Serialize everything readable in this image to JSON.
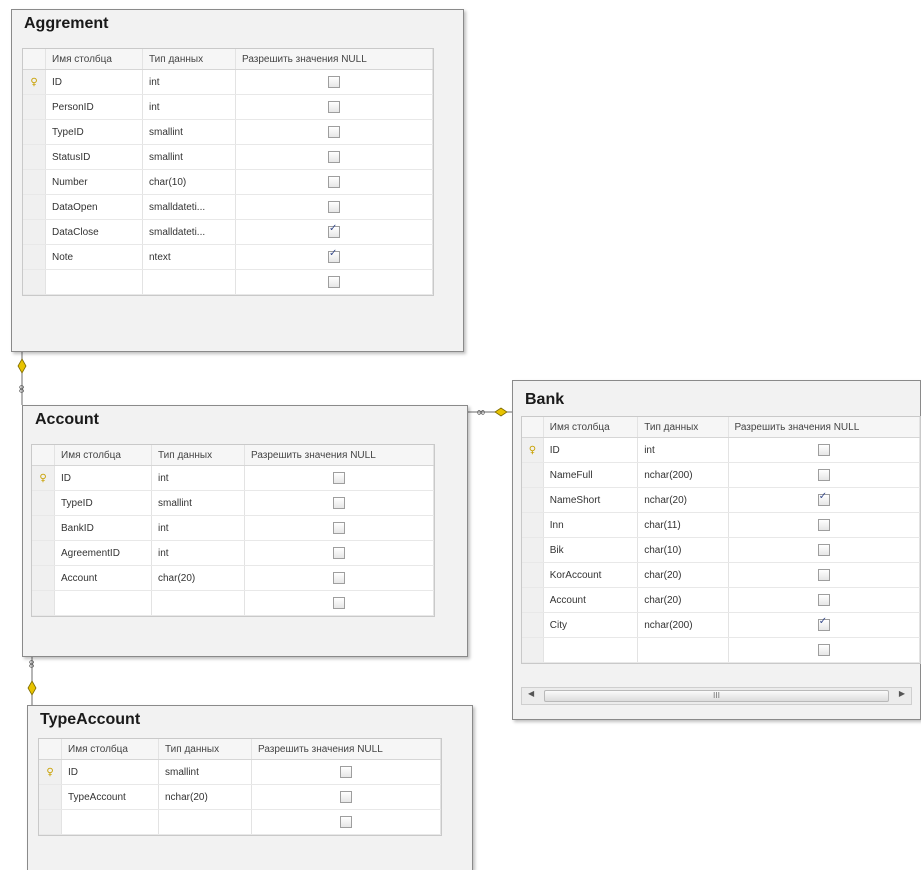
{
  "headers": [
    "Имя столбца",
    "Тип данных",
    "Разрешить значения NULL"
  ],
  "tables": [
    {
      "title": "Aggrement",
      "rows": [
        {
          "name": "ID",
          "type": "int",
          "nullable": false,
          "pk": true
        },
        {
          "name": "PersonID",
          "type": "int",
          "nullable": false
        },
        {
          "name": "TypeID",
          "type": "smallint",
          "nullable": false
        },
        {
          "name": "StatusID",
          "type": "smallint",
          "nullable": false
        },
        {
          "name": "Number",
          "type": "char(10)",
          "nullable": false
        },
        {
          "name": "DataOpen",
          "type": "smalldateti...",
          "nullable": false
        },
        {
          "name": "DataClose",
          "type": "smalldateti...",
          "nullable": true
        },
        {
          "name": "Note",
          "type": "ntext",
          "nullable": true
        },
        {
          "name": "",
          "type": "",
          "nullable": false
        }
      ]
    },
    {
      "title": "Account",
      "rows": [
        {
          "name": "ID",
          "type": "int",
          "nullable": false,
          "pk": true
        },
        {
          "name": "TypeID",
          "type": "smallint",
          "nullable": false
        },
        {
          "name": "BankID",
          "type": "int",
          "nullable": false
        },
        {
          "name": "AgreementID",
          "type": "int",
          "nullable": false
        },
        {
          "name": "Account",
          "type": "char(20)",
          "nullable": false
        },
        {
          "name": "",
          "type": "",
          "nullable": false
        }
      ]
    },
    {
      "title": "Bank",
      "rows": [
        {
          "name": "ID",
          "type": "int",
          "nullable": false,
          "pk": true
        },
        {
          "name": "NameFull",
          "type": "nchar(200)",
          "nullable": false
        },
        {
          "name": "NameShort",
          "type": "nchar(20)",
          "nullable": true
        },
        {
          "name": "Inn",
          "type": "char(11)",
          "nullable": false
        },
        {
          "name": "Bik",
          "type": "char(10)",
          "nullable": false
        },
        {
          "name": "KorAccount",
          "type": "char(20)",
          "nullable": false
        },
        {
          "name": "Account",
          "type": "char(20)",
          "nullable": false
        },
        {
          "name": "City",
          "type": "nchar(200)",
          "nullable": true
        },
        {
          "name": "",
          "type": "",
          "nullable": false
        }
      ],
      "scrollbar_label": "III"
    },
    {
      "title": "TypeAccount",
      "rows": [
        {
          "name": "ID",
          "type": "smallint",
          "nullable": false,
          "pk": true
        },
        {
          "name": "TypeAccount",
          "type": "nchar(20)",
          "nullable": false
        },
        {
          "name": "",
          "type": "",
          "nullable": false
        }
      ]
    }
  ],
  "icons": {
    "pk": "primary-key-icon",
    "connector_end": "relationship-key-icon",
    "connector_many": "relationship-infinity-icon"
  }
}
